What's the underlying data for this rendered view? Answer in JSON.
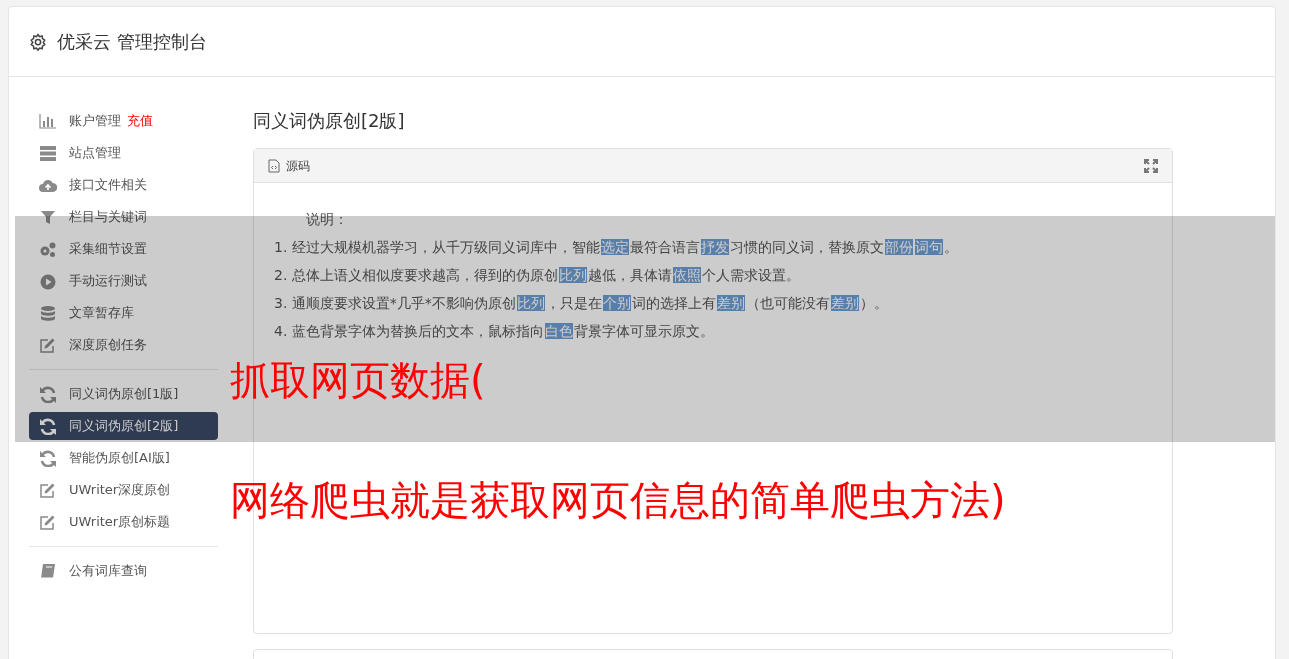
{
  "header": {
    "title": "优采云 管理控制台"
  },
  "sidebar": {
    "groups": [
      {
        "items": [
          {
            "kind": "chart",
            "label": "账户管理",
            "badge": "充值",
            "selected": false
          },
          {
            "kind": "server",
            "label": "站点管理",
            "selected": false
          },
          {
            "kind": "cloud",
            "label": "接口文件相关",
            "selected": false
          },
          {
            "kind": "filter",
            "label": "栏目与关键词",
            "selected": false
          },
          {
            "kind": "gears",
            "label": "采集细节设置",
            "selected": false
          },
          {
            "kind": "play",
            "label": "手动运行测试",
            "selected": false
          },
          {
            "kind": "database",
            "label": "文章暂存库",
            "selected": false
          },
          {
            "kind": "edit",
            "label": "深度原创任务",
            "selected": false
          }
        ]
      },
      {
        "items": [
          {
            "kind": "refresh",
            "label": "同义词伪原创[1版]",
            "selected": false
          },
          {
            "kind": "refresh",
            "label": "同义词伪原创[2版]",
            "selected": true
          },
          {
            "kind": "refresh",
            "label": "智能伪原创[AI版]",
            "selected": false
          },
          {
            "kind": "edit",
            "label": "UWriter深度原创",
            "selected": false
          },
          {
            "kind": "edit",
            "label": "UWriter原创标题",
            "selected": false
          }
        ]
      },
      {
        "items": [
          {
            "kind": "book",
            "label": "公有词库查询",
            "selected": false
          }
        ]
      }
    ]
  },
  "content": {
    "title": "同义词伪原创[2版]",
    "panel": {
      "title": "源码",
      "heading": "说明：",
      "lines": [
        [
          {
            "text": "1. 经过大规模机器学习，从千万级同义词库中，智能",
            "highlighted": false
          },
          {
            "text": "选定",
            "highlighted": true
          },
          {
            "text": "最符合语言",
            "highlighted": false
          },
          {
            "text": "抒发",
            "highlighted": true
          },
          {
            "text": "习惯的同义词，替换原文",
            "highlighted": false
          },
          {
            "text": "部份",
            "highlighted": true
          },
          {
            "text": "词句",
            "highlighted": true
          },
          {
            "text": "。",
            "highlighted": false
          }
        ],
        [
          {
            "text": "2. 总体上语义相似度要求越高，得到的伪原创",
            "highlighted": false
          },
          {
            "text": "比列",
            "highlighted": true
          },
          {
            "text": "越低，具体请",
            "highlighted": false
          },
          {
            "text": "依照",
            "highlighted": true
          },
          {
            "text": "个人需求设置。",
            "highlighted": false
          }
        ],
        [
          {
            "text": "3. 通顺度要求设置*几乎*不影响伪原创",
            "highlighted": false
          },
          {
            "text": "比列",
            "highlighted": true
          },
          {
            "text": "，只是在",
            "highlighted": false
          },
          {
            "text": "个别",
            "highlighted": true
          },
          {
            "text": "词的选择上有",
            "highlighted": false
          },
          {
            "text": "差别",
            "highlighted": true
          },
          {
            "text": "（也可能没有",
            "highlighted": false
          },
          {
            "text": "差别",
            "highlighted": true
          },
          {
            "text": "）。",
            "highlighted": false
          }
        ],
        [
          {
            "text": "4. 蓝色背景字体为替换后的文本，鼠标指向",
            "highlighted": false
          },
          {
            "text": "白色",
            "highlighted": true
          },
          {
            "text": "背景字体可显示原文。",
            "highlighted": false
          }
        ]
      ]
    }
  },
  "overlay": {
    "lines": [
      "抓取网页数据(",
      "网络爬虫就是获取网页信息的简单爬虫方法)"
    ]
  }
}
